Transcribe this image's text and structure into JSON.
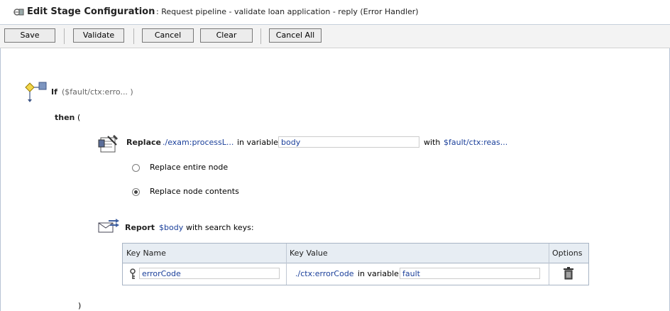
{
  "header": {
    "title": "Edit Stage Configuration",
    "subtitle": ": Request pipeline - validate loan application - reply (Error Handler)"
  },
  "toolbar": {
    "save_label": "Save",
    "validate_label": "Validate",
    "cancel_label": "Cancel",
    "clear_label": "Clear",
    "cancel_all_label": "Cancel All"
  },
  "if_block": {
    "keyword": "If",
    "condition": "($fault/ctx:erro... )",
    "then_keyword": "then",
    "open_paren": "(",
    "close_paren": ")"
  },
  "replace_action": {
    "keyword": "Replace",
    "xpath": "./exam:processL...",
    "in_variable_label": "in variable",
    "variable": "body",
    "with_label": "with",
    "with_expression": "$fault/ctx:reas...",
    "options": [
      {
        "label": "Replace entire node",
        "selected": false
      },
      {
        "label": "Replace node contents",
        "selected": true
      }
    ]
  },
  "report_action": {
    "keyword": "Report",
    "variable": "$body",
    "search_keys_label": "with search keys:",
    "table": {
      "columns": [
        "Key Name",
        "Key Value",
        "Options"
      ],
      "rows": [
        {
          "key_name": "errorCode",
          "key_value_xpath": "./ctx:errorCode",
          "in_variable_label": "in variable",
          "key_value_variable": "fault"
        }
      ]
    }
  },
  "icons": {
    "header": "stage-config-icon",
    "if": "if-branch-icon",
    "replace": "replace-action-icon",
    "report": "report-action-icon",
    "key": "key-icon",
    "delete": "trash-icon"
  }
}
